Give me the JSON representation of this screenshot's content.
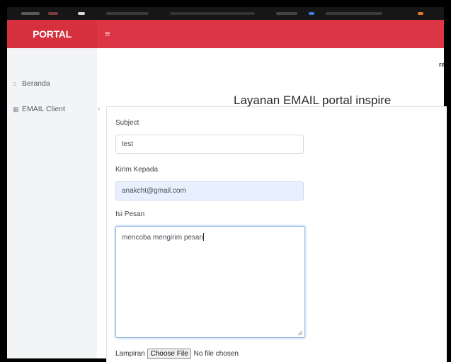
{
  "brand": {
    "title": "PORTAL"
  },
  "topbar": {
    "menu_icon": "hamburger-icon",
    "menu_glyph": "≡"
  },
  "sidebar": {
    "items": [
      {
        "label": "Beranda",
        "icon": "home-icon",
        "glyph": "⌂"
      },
      {
        "label": "EMAIL Client",
        "icon": "grid-icon",
        "glyph": "▦",
        "chevron": "›"
      }
    ]
  },
  "header": {
    "user_snippet": "ra"
  },
  "main": {
    "title": "Layanan EMAIL portal inspire",
    "subject": {
      "label": "Subject",
      "value": "test"
    },
    "recipient": {
      "label": "Kirim Kepada",
      "value": "anakcht@gmail.com"
    },
    "message": {
      "label": "Isi Pesan",
      "value": "mencoba mengirim pesan"
    },
    "attachment": {
      "label": "Lampiran",
      "button_label": "Choose File",
      "status": "No file chosen"
    }
  },
  "colors": {
    "brand_red": "#dc3545",
    "sidebar_bg": "#f3f4f6",
    "autofill_bg": "#e8f0fe",
    "focus_border": "#90b8e8"
  }
}
